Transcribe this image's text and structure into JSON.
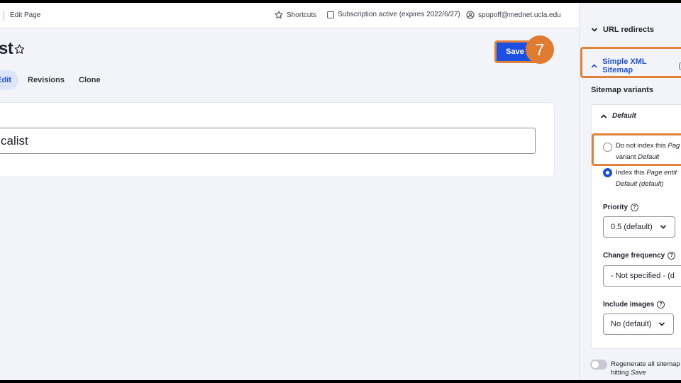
{
  "toolbar": {
    "edit_page": "Edit Page",
    "shortcuts": "Shortcuts",
    "subscription": "Subscription active (expires 2022/6/27)",
    "user_email": "spopoff@mednet.ucla.edu"
  },
  "header": {
    "title": "st",
    "save_label": "Save",
    "step_number": "7"
  },
  "tabs": {
    "edit": "Edit",
    "revisions": "Revisions",
    "clone": "Clone"
  },
  "main": {
    "title_value": "calist"
  },
  "sidebar": {
    "url_redirects": "URL redirects",
    "xml_sitemap": "Simple XML Sitemap",
    "xml_sitemap_trailing": "(",
    "variants_label": "Sitemap variants",
    "default_header": "Default",
    "option_no_index": {
      "line1_prefix": "Do not index this ",
      "line1_em": "Pag",
      "line2_prefix": "variant ",
      "line2_em": "Default"
    },
    "option_index": {
      "line1_prefix": "Index this ",
      "line1_em": "Page entit",
      "line2_em": "Default (default)"
    },
    "priority": {
      "label": "Priority",
      "value": "0.5 (default)"
    },
    "change_frequency": {
      "label": "Change frequency",
      "value": "- Not specified - (d"
    },
    "include_images": {
      "label": "Include images",
      "value": "No (default)"
    },
    "regenerate": {
      "line1": "Regenerate all sitemap",
      "line2_prefix": "hitting ",
      "line2_em": "Save"
    }
  },
  "colors": {
    "accent": "#1d4fe0",
    "highlight": "#e0823a",
    "background": "#f3f4f9"
  }
}
